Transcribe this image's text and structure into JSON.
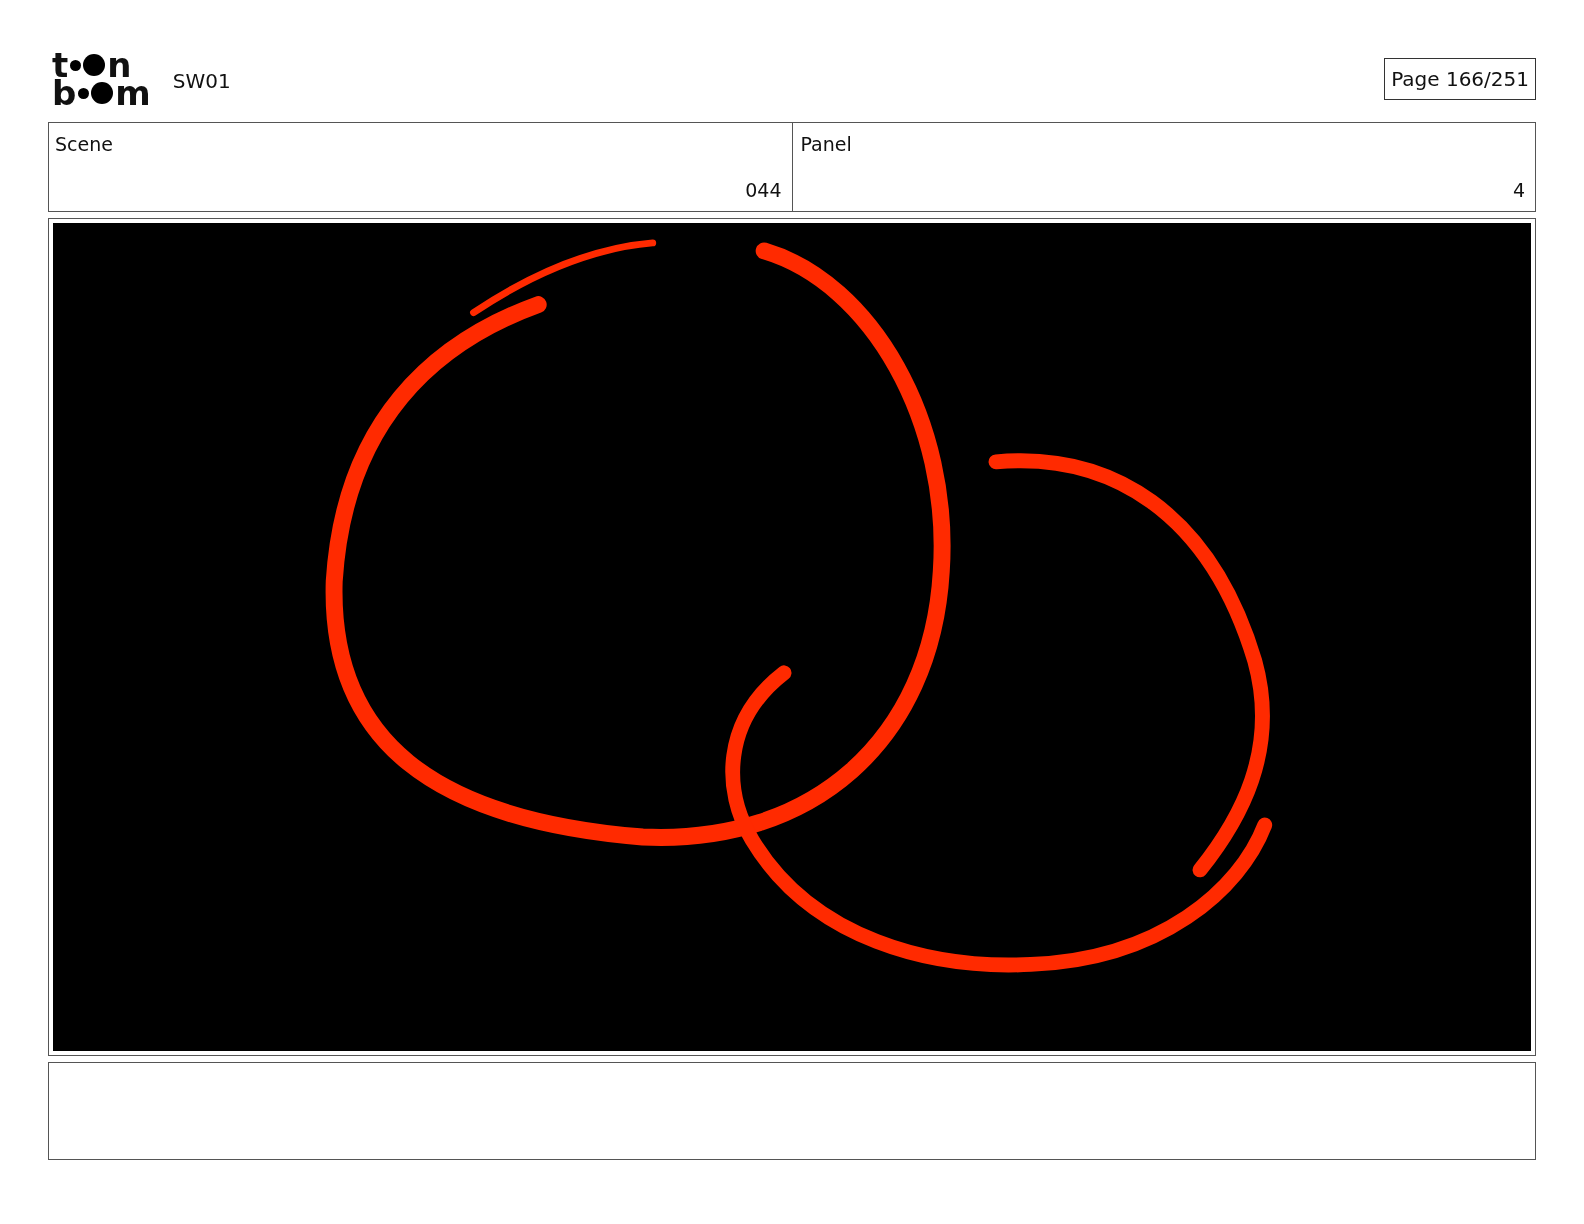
{
  "logo": {
    "rows": [
      {
        "left": "t",
        "right": "n"
      },
      {
        "left": "b",
        "right": "m"
      }
    ]
  },
  "project": "SW01",
  "page": "Page 166/251",
  "fields": [
    {
      "label": "Scene",
      "value": "044"
    },
    {
      "label": "Panel",
      "value": "4"
    }
  ]
}
